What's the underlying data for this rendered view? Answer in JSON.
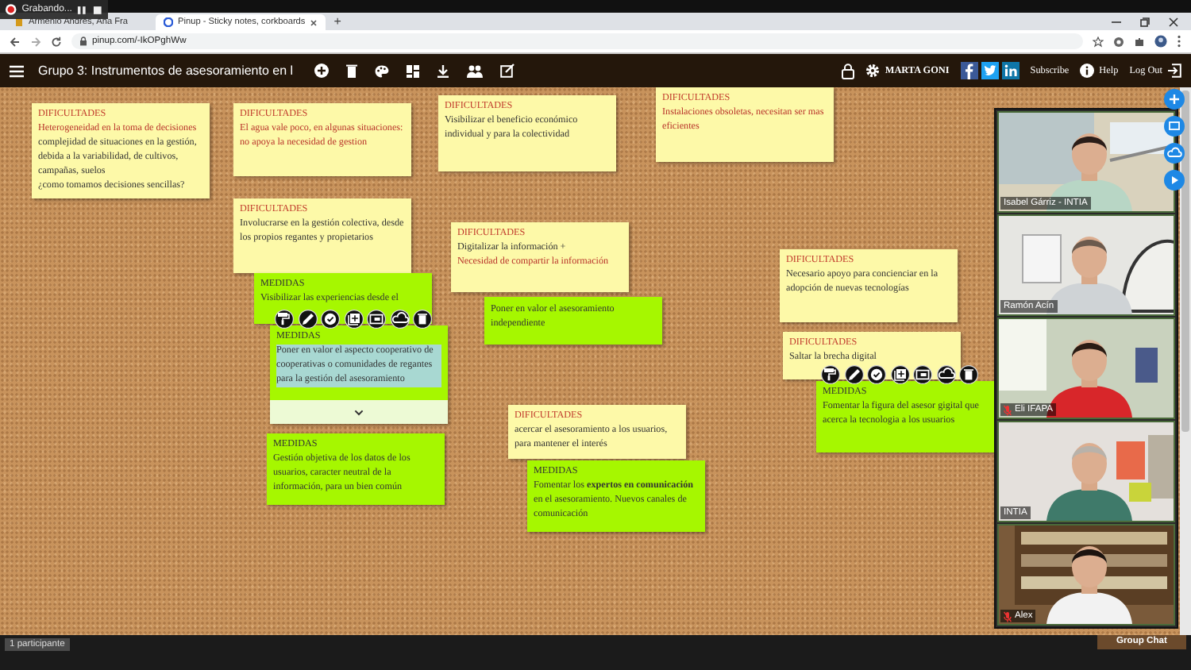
{
  "browser": {
    "recording": {
      "label": "Grabando..."
    },
    "tabs": [
      {
        "title": "Armenio Andrés, Ana Fra",
        "selected": false
      },
      {
        "title": "Pinup - Sticky notes, corkboards",
        "selected": true
      }
    ],
    "new_tab": "+",
    "url": "pinup.com/-IkOPghWw"
  },
  "app_bar": {
    "title": "Grupo 3: Instrumentos de asesoramiento en l",
    "user": "MARTA GONI",
    "subscribe": "Subscribe",
    "help": "Help",
    "logout": "Log Out"
  },
  "notes": [
    {
      "kind": "dificultad",
      "heading": "DIFICULTADES",
      "selected": false,
      "toolbar_open": false,
      "lines": [
        {
          "text": "Heterogeneidad en la toma de decisiones",
          "color": "#b8322a"
        },
        {
          "text": "complejidad de situaciones en la gestión, debida a la variabilidad, de cultivos, campañas, suelos",
          "color": "#333333"
        },
        {
          "text": "¿como tomamos decisiones sencillas?",
          "color": "#333333"
        }
      ]
    },
    {
      "kind": "dificultad",
      "heading": "DIFICULTADES",
      "selected": false,
      "toolbar_open": false,
      "lines": [
        {
          "text": "El agua vale poco, en algunas situaciones: no apoya la necesidad de gestion",
          "color": "#b8322a"
        }
      ]
    },
    {
      "kind": "dificultad",
      "heading": "DIFICULTADES",
      "selected": false,
      "toolbar_open": false,
      "lines": [
        {
          "text": "Visibilizar el beneficio económico individual y para la colectividad",
          "color": "#333333"
        }
      ]
    },
    {
      "kind": "dificultad",
      "heading": "DIFICULTADES",
      "selected": false,
      "toolbar_open": false,
      "lines": [
        {
          "text": "Instalaciones obsoletas, necesitan ser mas eficientes",
          "color": "#b8322a"
        }
      ]
    },
    {
      "kind": "dificultad",
      "heading": "DIFICULTADES",
      "selected": false,
      "toolbar_open": false,
      "lines": [
        {
          "text": "Involucrarse en la gestión colectiva, desde los propios regantes y propietarios",
          "color": "#333333"
        }
      ]
    },
    {
      "kind": "medida",
      "heading": "MEDIDAS",
      "selected": false,
      "toolbar_open": false,
      "lines": [
        {
          "text": "Visibilizar las experiencias desde el",
          "color": "#333333"
        }
      ]
    },
    {
      "kind": "medida",
      "heading": "MEDIDAS",
      "selected": true,
      "toolbar_open": true,
      "lines": [
        {
          "text": "Poner en valor el aspecto cooperativo de cooperativas o comunidades de regantes para la gestión del asesoramiento"
        }
      ]
    },
    {
      "kind": "dificultad",
      "heading": "DIFICULTADES",
      "selected": false,
      "toolbar_open": false,
      "lines": [
        {
          "text": "Digitalizar la información +",
          "color": "#333333"
        },
        {
          "text": "Necesidad de compartir la información",
          "color": "#b8322a"
        }
      ]
    },
    {
      "kind": "medida",
      "selected": false,
      "toolbar_open": false,
      "lines": [
        {
          "text": "Poner en valor el asesoramiento independiente",
          "color": "#333333"
        }
      ]
    },
    {
      "kind": "medida",
      "heading": "MEDIDAS",
      "selected": false,
      "toolbar_open": false,
      "lines": [
        {
          "text": "Gestión objetiva de los datos de los usuarios, caracter neutral de la información, para un bien común",
          "color": "#333333"
        }
      ]
    },
    {
      "kind": "dificultad",
      "heading": "DIFICULTADES",
      "selected": false,
      "toolbar_open": false,
      "lines": [
        {
          "text": "acercar el asesoramiento a los usuarios, para mantener el interés",
          "color": "#333333"
        }
      ]
    },
    {
      "kind": "medida",
      "heading": "MEDIDAS",
      "selected": false,
      "toolbar_open": false,
      "lines": [
        {
          "text": "Fomentar los **expertos en comunicación** en el asesoramiento. Nuevos canales de comunicación",
          "color": "#333333"
        }
      ]
    },
    {
      "kind": "dificultad",
      "heading": "DIFICULTADES",
      "selected": false,
      "toolbar_open": false,
      "lines": [
        {
          "text": "Necesario apoyo para concienciar en la adopción de nuevas tecnologías",
          "color": "#333333"
        }
      ]
    },
    {
      "kind": "dificultad",
      "heading": "DIFICULTADES",
      "selected": false,
      "toolbar_open": false,
      "lines": [
        {
          "text": "Saltar la brecha digital",
          "color": "#333333"
        }
      ]
    },
    {
      "kind": "medida",
      "heading": "MEDIDAS",
      "selected": false,
      "toolbar_open": true,
      "lines": [
        {
          "text": "Fomentar la figura del asesor gigital que acerca la tecnologia a los usuarios",
          "color": "#333333"
        }
      ]
    }
  ],
  "video_call": {
    "participants": [
      {
        "name": "Isabel Gárriz - INTIA",
        "muted": false
      },
      {
        "name": "Ramón Acín",
        "muted": false
      },
      {
        "name": "Eli IFAPA",
        "muted": true
      },
      {
        "name": "INTIA",
        "muted": false
      },
      {
        "name": "Alex",
        "muted": true
      }
    ]
  },
  "footer": {
    "participants": "1 participante",
    "chat": "Group Chat"
  }
}
